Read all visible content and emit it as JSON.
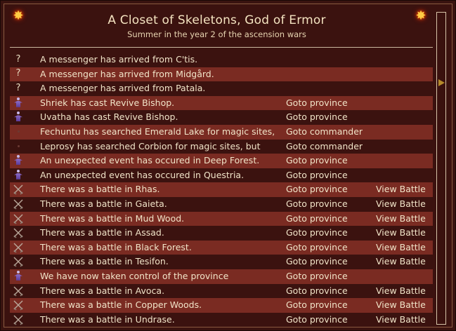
{
  "header": {
    "title": "A Closet of Skeletons, God of Ermor",
    "subtitle": "Summer in the year 2 of the ascension wars"
  },
  "icons": {
    "corner": "sun-burst-icon",
    "question": "question-icon",
    "battle": "crossed-swords-icon",
    "figure": "bishop-figure-icon",
    "dot": "dot-icon"
  },
  "messages": [
    {
      "icon": "question",
      "text": "A messenger has arrived from C'tis.",
      "goto": "",
      "view": ""
    },
    {
      "icon": "question",
      "text": "A messenger has arrived from Midgård.",
      "goto": "",
      "view": ""
    },
    {
      "icon": "question",
      "text": "A messenger has arrived from Patala.",
      "goto": "",
      "view": ""
    },
    {
      "icon": "figure",
      "text": "Shriek has cast Revive Bishop.",
      "goto": "Goto province",
      "view": ""
    },
    {
      "icon": "figure",
      "text": "Uvatha has cast Revive Bishop.",
      "goto": "Goto province",
      "view": ""
    },
    {
      "icon": "dot",
      "text": "Fechuntu has searched Emerald Lake for magic sites,",
      "goto": "Goto commander",
      "view": ""
    },
    {
      "icon": "dot",
      "text": "Leprosy has searched Corbion for magic sites, but",
      "goto": "Goto commander",
      "view": ""
    },
    {
      "icon": "figure",
      "text": "An unexpected event has occured in Deep Forest.",
      "goto": "Goto province",
      "view": ""
    },
    {
      "icon": "figure",
      "text": "An unexpected event has occured in Questria.",
      "goto": "Goto province",
      "view": ""
    },
    {
      "icon": "battle",
      "text": "There was a battle in Rhas.",
      "goto": "Goto province",
      "view": "View Battle"
    },
    {
      "icon": "battle",
      "text": "There was a battle in Gaieta.",
      "goto": "Goto province",
      "view": "View Battle"
    },
    {
      "icon": "battle",
      "text": "There was a battle in Mud Wood.",
      "goto": "Goto province",
      "view": "View Battle"
    },
    {
      "icon": "battle",
      "text": "There was a battle in Assad.",
      "goto": "Goto province",
      "view": "View Battle"
    },
    {
      "icon": "battle",
      "text": "There was a battle in Black Forest.",
      "goto": "Goto province",
      "view": "View Battle"
    },
    {
      "icon": "battle",
      "text": "There was a battle in Tesifon.",
      "goto": "Goto province",
      "view": "View Battle"
    },
    {
      "icon": "figure",
      "text": "We have now taken control of the province",
      "goto": "Goto province",
      "view": ""
    },
    {
      "icon": "battle",
      "text": "There was a battle in Avoca.",
      "goto": "Goto province",
      "view": "View Battle"
    },
    {
      "icon": "battle",
      "text": "There was a battle in Copper Woods.",
      "goto": "Goto province",
      "view": "View Battle"
    },
    {
      "icon": "battle",
      "text": "There was a battle in Undrase.",
      "goto": "Goto province",
      "view": "View Battle"
    }
  ],
  "scroll": {
    "position": 0.22
  }
}
